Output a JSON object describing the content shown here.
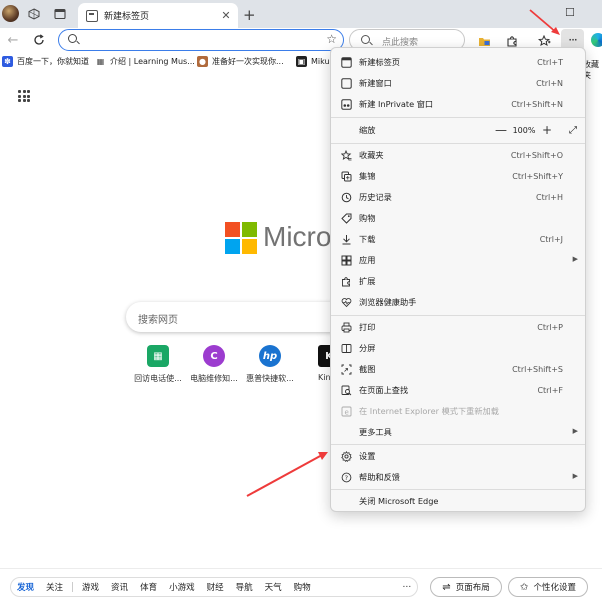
{
  "tab": {
    "title": "新建标签页",
    "close": "✕"
  },
  "titlebar": {
    "new_tab": "+",
    "restore": "☐"
  },
  "address": {
    "value": "",
    "star": "☆"
  },
  "search_box": {
    "placeholder": "点此搜索"
  },
  "toolbar": {
    "more": "···"
  },
  "favorites": {
    "items": [
      {
        "label": "百度一下，你就知道",
        "color": "#2e5be0",
        "glyph": "✽"
      },
      {
        "label": "介绍 | Learning Mus...",
        "color": "#444444",
        "glyph": "▦"
      },
      {
        "label": "准备好一次实现你...",
        "color": "#b06a3c",
        "glyph": "●"
      },
      {
        "label": "Miku",
        "color": "#222222",
        "glyph": "▣"
      }
    ],
    "overflow": "收藏夹"
  },
  "main": {
    "brand": "Micro",
    "search_placeholder": "搜索网页",
    "quick_links": [
      {
        "label": "回访电话使...",
        "glyph": "▦",
        "color": "#1aa765"
      },
      {
        "label": "电脑维修知...",
        "glyph": "C",
        "color": "#9c3ccf"
      },
      {
        "label": "惠普快捷软...",
        "glyph": "hp",
        "color": "#1a73d0"
      },
      {
        "label": "Kin",
        "glyph": "K",
        "color": "#111111"
      }
    ],
    "ms_colors": [
      "#f25022",
      "#7fba00",
      "#00a4ef",
      "#ffb900"
    ]
  },
  "menu": {
    "new_tab": {
      "label": "新建标签页",
      "shortcut": "Ctrl+T"
    },
    "new_window": {
      "label": "新建窗口",
      "shortcut": "Ctrl+N"
    },
    "new_inprivate": {
      "label": "新建 InPrivate 窗口",
      "shortcut": "Ctrl+Shift+N"
    },
    "zoom": {
      "label": "缩放",
      "minus": "—",
      "value": "100%",
      "plus": "+",
      "expand": "⤢"
    },
    "favorites": {
      "label": "收藏夹",
      "shortcut": "Ctrl+Shift+O"
    },
    "collections": {
      "label": "集锦",
      "shortcut": "Ctrl+Shift+Y"
    },
    "history": {
      "label": "历史记录",
      "shortcut": "Ctrl+H"
    },
    "shopping": {
      "label": "购物"
    },
    "downloads": {
      "label": "下载",
      "shortcut": "Ctrl+J"
    },
    "apps": {
      "label": "应用"
    },
    "extensions": {
      "label": "扩展"
    },
    "browser_health": {
      "label": "浏览器健康助手"
    },
    "print": {
      "label": "打印",
      "shortcut": "Ctrl+P"
    },
    "split_screen": {
      "label": "分屏"
    },
    "screenshot": {
      "label": "截图",
      "shortcut": "Ctrl+Shift+S"
    },
    "find": {
      "label": "在页面上查找",
      "shortcut": "Ctrl+F"
    },
    "ie_mode": {
      "label": "在 Internet Explorer 模式下重新加载"
    },
    "more_tools": {
      "label": "更多工具"
    },
    "settings": {
      "label": "设置"
    },
    "help": {
      "label": "帮助和反馈"
    },
    "close_edge": {
      "label": "关闭 Microsoft Edge"
    }
  },
  "bottom_nav": {
    "items": [
      "发现",
      "关注",
      "游戏",
      "资讯",
      "体育",
      "小游戏",
      "财经",
      "导航",
      "天气",
      "购物"
    ],
    "active": "发现",
    "more": "⋯",
    "layout_button": "页面布局",
    "personalize_button": "个性化设置"
  }
}
